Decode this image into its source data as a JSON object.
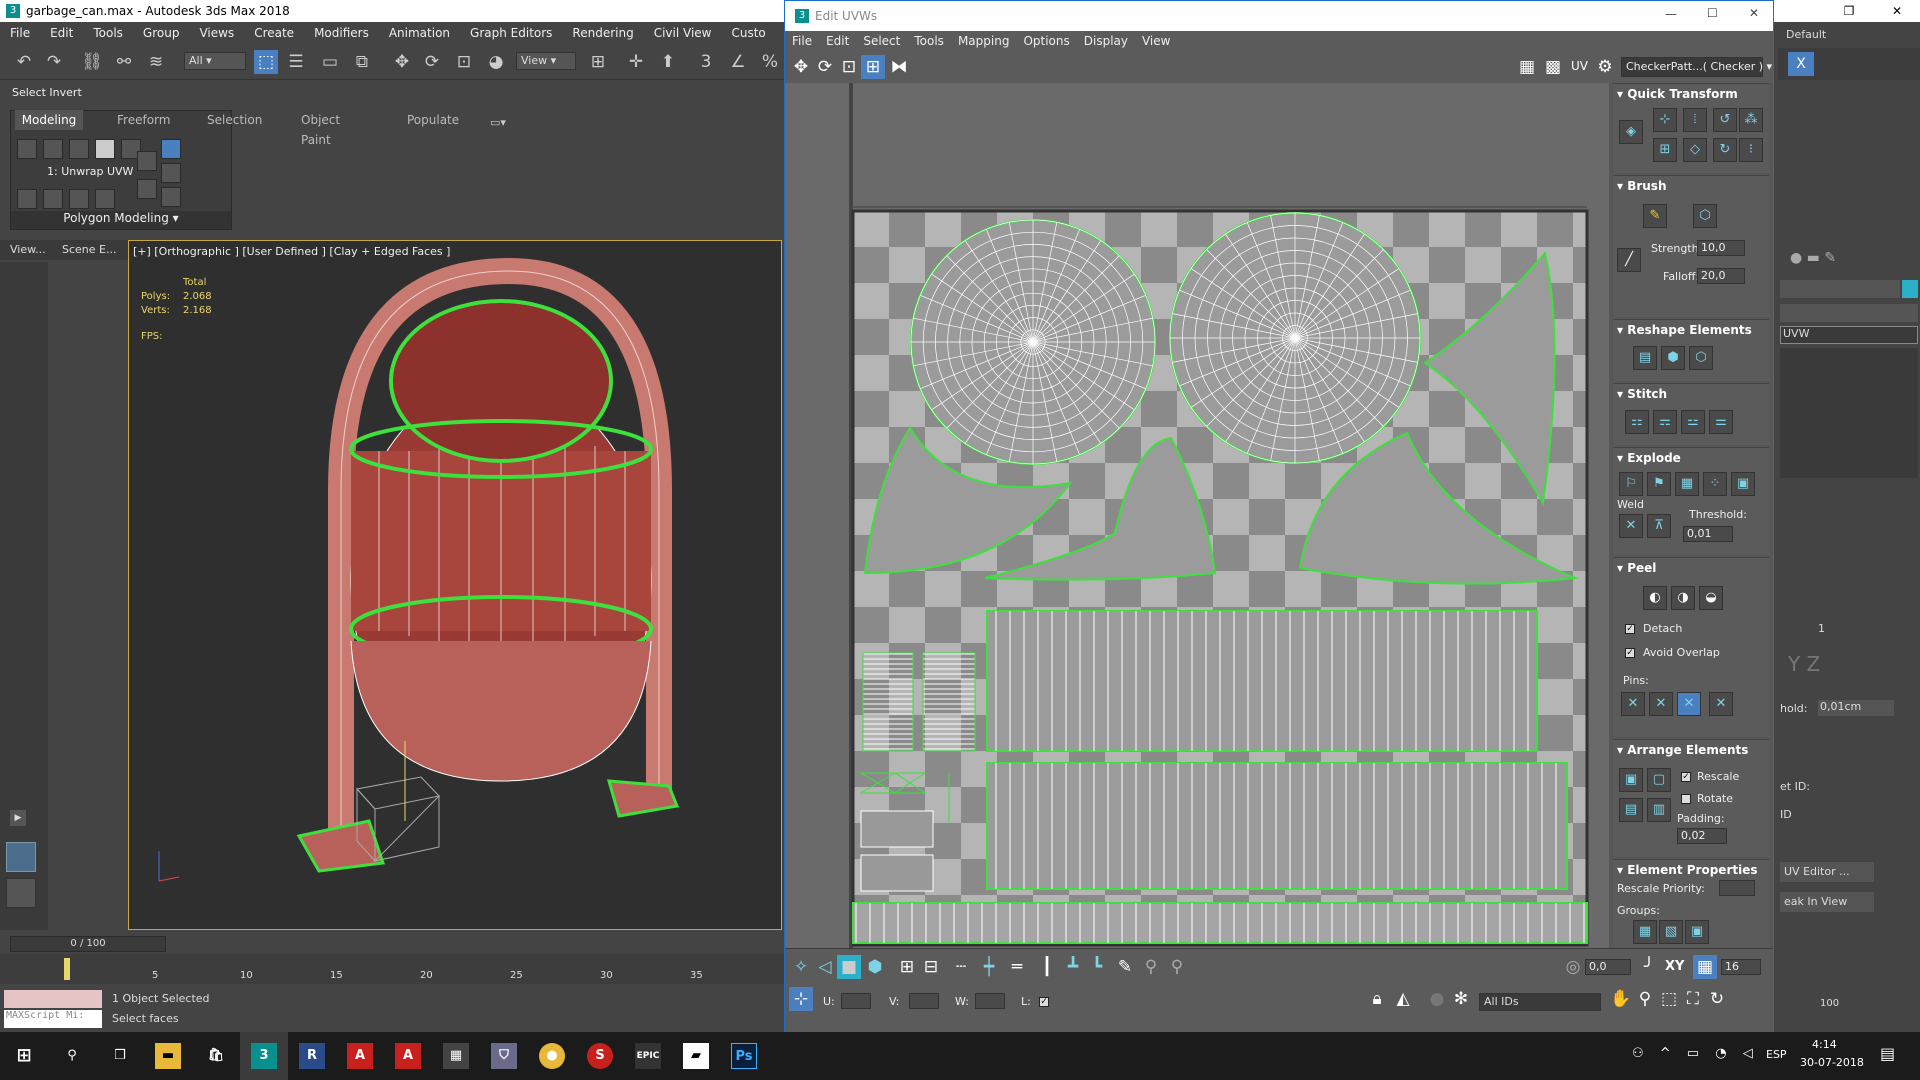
{
  "app": {
    "title": "garbage_can.max - Autodesk 3ds Max 2018",
    "menu": [
      "File",
      "Edit",
      "Tools",
      "Group",
      "Views",
      "Create",
      "Modifiers",
      "Animation",
      "Graph Editors",
      "Rendering",
      "Civil View",
      "Custo"
    ],
    "selection_filter": "All",
    "view_dropdown": "View",
    "status_prompt": "Select Invert",
    "workspace": "Default"
  },
  "ribbon": {
    "tabs": [
      "Modeling",
      "Freeform",
      "Selection",
      "Object Paint",
      "Populate"
    ],
    "active_tab": "Modeling",
    "modifier_label": "1: Unwrap UVW",
    "footer": "Polygon Modeling"
  },
  "scene_explorer": {
    "view_label": "View...",
    "scene_label": "Scene E..."
  },
  "viewport": {
    "label": "[+] [Orthographic ] [User Defined ] [Clay + Edged Faces ]",
    "stats_total": "Total",
    "polys_label": "Polys:",
    "polys_value": "2.068",
    "verts_label": "Verts:",
    "verts_value": "2.168",
    "fps_label": "FPS:"
  },
  "timeline": {
    "frame_display": "0 / 100",
    "ticks": [
      "5",
      "10",
      "15",
      "20",
      "25",
      "30",
      "35"
    ],
    "right_end": "100"
  },
  "statusbar": {
    "maxscript": "MAXScript Mi:",
    "objects_selected": "1 Object Selected",
    "prompt": "Select faces"
  },
  "uv_editor": {
    "title": "Edit UVWs",
    "menu": [
      "File",
      "Edit",
      "Select",
      "Tools",
      "Mapping",
      "Options",
      "Display",
      "View"
    ],
    "uv_label": "UV",
    "checker_dropdown": "CheckerPatt...( Checker )",
    "rollouts": {
      "quick_transform": "Quick Transform",
      "brush": "Brush",
      "strength_label": "Strength:",
      "strength_value": "10,0",
      "falloff_label": "Falloff:",
      "falloff_value": "20,0",
      "reshape": "Reshape Elements",
      "stitch": "Stitch",
      "explode": "Explode",
      "weld_label": "Weld",
      "threshold_label": "Threshold:",
      "threshold_value": "0,01",
      "peel": "Peel",
      "detach_label": "Detach",
      "avoid_overlap_label": "Avoid Overlap",
      "pins_label": "Pins:",
      "arrange": "Arrange Elements",
      "rescale_label": "Rescale",
      "rotate_label": "Rotate",
      "padding_label": "Padding:",
      "padding_value": "0,02",
      "element_props": "Element Properties",
      "rescale_priority_label": "Rescale Priority:",
      "groups_label": "Groups:"
    },
    "bottom": {
      "value_spinner": "0,0",
      "axis_label": "XY",
      "grid_value": "16",
      "u_label": "U:",
      "v_label": "V:",
      "w_label": "W:",
      "l_label": "L:",
      "ids_dropdown": "All IDs"
    }
  },
  "command_panel": {
    "modifier_name": "UVW",
    "threshold_label": "hold:",
    "threshold_value": "0,01cm",
    "spinner_value": "1",
    "set_id_label": "et ID:",
    "id_label": "ID",
    "uv_editor_button": "UV Editor ...",
    "peak_button": "eak In View",
    "axis_letters": "Y Z"
  },
  "taskbar": {
    "time": "4:14",
    "date": "30-07-2018",
    "lang": "ESP"
  }
}
